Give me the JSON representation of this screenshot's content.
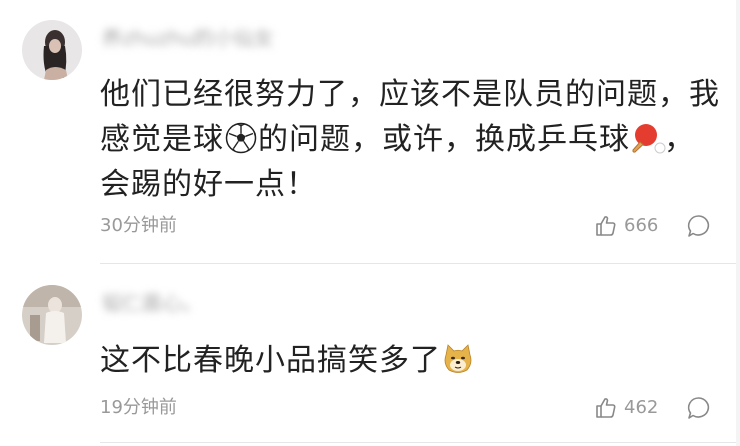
{
  "comments": [
    {
      "username": "养zhuzhu的小仙女",
      "content_parts": [
        "他们已经很努力了，应该不是队员的问题，我感觉是球",
        "的问题，或许，换成乒乓球",
        "，会踢的好一点！"
      ],
      "emojis": [
        "soccer-ball-icon",
        "ping-pong-icon"
      ],
      "time": "30分钟前",
      "likes": "666"
    },
    {
      "username": "韬仁晨心。",
      "content_parts": [
        "这不比春晚小品搞笑多了"
      ],
      "emojis": [
        "doge-icon"
      ],
      "time": "19分钟前",
      "likes": "462"
    }
  ],
  "colors": {
    "text": "#222222",
    "meta": "#999999",
    "divider": "#e6e6e6"
  }
}
